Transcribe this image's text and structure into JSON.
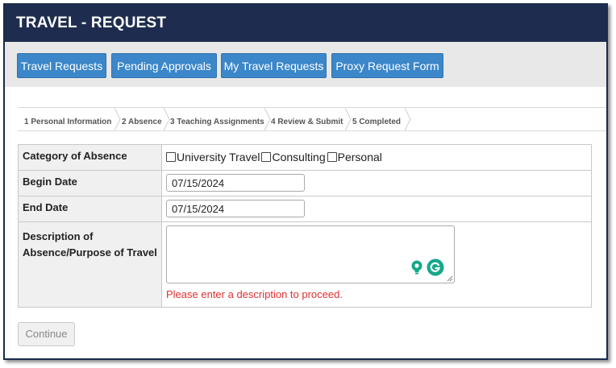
{
  "header": {
    "title": "TRAVEL - REQUEST"
  },
  "nav": {
    "buttons": [
      {
        "label": "Travel Requests"
      },
      {
        "label": "Pending Approvals"
      },
      {
        "label": "My Travel Requests"
      },
      {
        "label": "Proxy Request Form"
      }
    ]
  },
  "steps": [
    {
      "label": "1 Personal Information"
    },
    {
      "label": "2 Absence"
    },
    {
      "label": "3 Teaching Assignments"
    },
    {
      "label": "4 Review & Submit"
    },
    {
      "label": "5 Completed"
    }
  ],
  "form": {
    "category": {
      "label": "Category of Absence",
      "options": [
        {
          "label": "University Travel",
          "checked": false
        },
        {
          "label": "Consulting",
          "checked": false
        },
        {
          "label": "Personal",
          "checked": false
        }
      ]
    },
    "begin_date": {
      "label": "Begin Date",
      "value": "07/15/2024"
    },
    "end_date": {
      "label": "End Date",
      "value": "07/15/2024"
    },
    "description": {
      "label_line1": "Description of",
      "label_line2": "Absence/Purpose of Travel",
      "value": "",
      "error": "Please enter a description to proceed."
    }
  },
  "continue_label": "Continue",
  "icons": {
    "lightbulb": "lightbulb-icon",
    "grammarly": "grammarly-icon"
  },
  "colors": {
    "header": "#1e2d4f",
    "nav_button": "#3b87c9",
    "error": "#e03030",
    "grammarly": "#15a88a"
  }
}
